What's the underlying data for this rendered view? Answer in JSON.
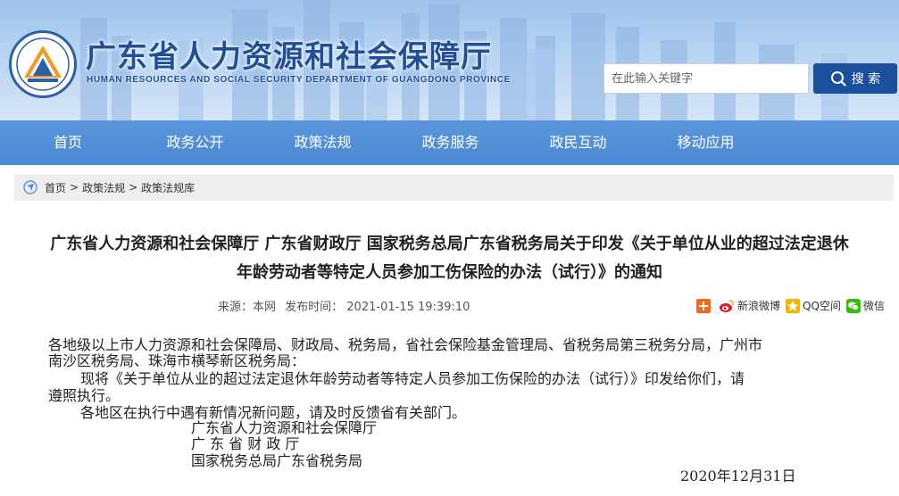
{
  "header": {
    "site_title": "广东省人力资源和社会保障厅",
    "site_subtitle": "HUMAN RESOURCES AND SOCIAL SECURITY DEPARTMENT OF GUANGDONG PROVINCE",
    "search_placeholder": "在此输入关键字",
    "search_label": "搜 索"
  },
  "nav": {
    "items": [
      "首页",
      "政务公开",
      "政策法规",
      "政务服务",
      "政民互动",
      "移动应用"
    ]
  },
  "breadcrumb": {
    "items": [
      "首页",
      "政策法规",
      "政策法规库"
    ],
    "separator": ">"
  },
  "article": {
    "title_line1": "广东省人力资源和社会保障厅 广东省财政厅 国家税务总局广东省税务局关于印发《关于单位从业的超过法定退休",
    "title_line2": "年龄劳动者等特定人员参加工伤保险的办法（试行）》的通知",
    "source": "来源：本网",
    "publish_time": "发布时间：  2021-01-15 19:39:10",
    "share": {
      "weibo": "新浪微博",
      "qzone": "QQ空间",
      "wechat": "微信"
    },
    "paragraphs": {
      "p1_line1": "各地级以上市人力资源和社会保障局、财政局、税务局，省社会保险基金管理局、省税务局第三税务分局，广州市",
      "p1_line2": "南沙区税务局、珠海市横琴新区税务局：",
      "p2_line1": "现将《关于单位从业的超过法定退休年龄劳动者等特定人员参加工伤保险的办法（试行）》印发给你们，请",
      "p2_line2": "遵照执行。",
      "p3": "各地区在执行中遇有新情况新问题，请及时反馈省有关部门。"
    },
    "signatures": [
      "广东省人力资源和社会保障厅",
      "广 东 省 财 政 厅",
      "国家税务总局广东省税务局"
    ],
    "date": "2020年12月31日"
  },
  "colors": {
    "brand_blue": "#1f4f99",
    "nav_blue": "#4a88d2",
    "search_button": "#1a4f9c"
  }
}
